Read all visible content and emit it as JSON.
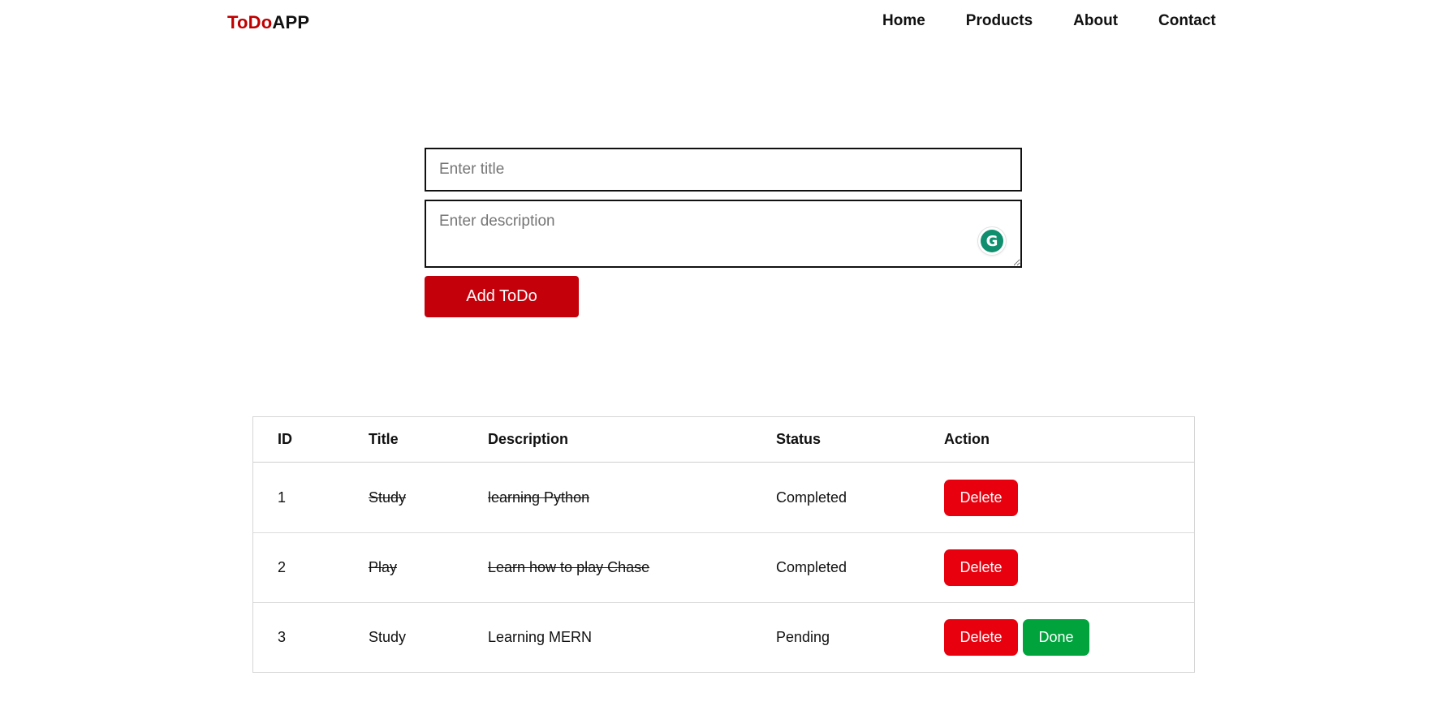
{
  "navbar": {
    "brand_part1": "ToDo",
    "brand_part2": "APP",
    "links": [
      "Home",
      "Products",
      "About",
      "Contact"
    ]
  },
  "form": {
    "title_placeholder": "Enter title",
    "title_value": "",
    "description_placeholder": "Enter description",
    "description_value": "",
    "grammarly_icon": "grammarly-icon",
    "add_button": "Add ToDo"
  },
  "table": {
    "headers": [
      "ID",
      "Title",
      "Description",
      "Status",
      "Action"
    ],
    "rows": [
      {
        "id": "1",
        "title": "Study",
        "description": "learning Python",
        "status": "Completed",
        "delete": "Delete"
      },
      {
        "id": "2",
        "title": "Play",
        "description": "Learn how to play Chase",
        "status": "Completed",
        "delete": "Delete"
      },
      {
        "id": "3",
        "title": "Study",
        "description": "Learning MERN",
        "status": "Pending",
        "delete": "Delete",
        "done": "Done"
      }
    ]
  },
  "colors": {
    "brand_red": "#c00000",
    "add_button": "#c4000a",
    "delete_button": "#e8000e",
    "done_button": "#00a33c"
  }
}
